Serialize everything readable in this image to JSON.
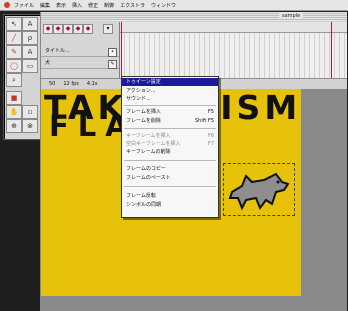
{
  "menubar": {
    "items": [
      "ファイル",
      "編集",
      "表示",
      "挿入",
      "修正",
      "制御",
      "エクストラ",
      "ウィンドウ"
    ]
  },
  "window": {
    "title": "sample"
  },
  "timeline": {
    "layers": [
      {
        "name": "タイトル..."
      },
      {
        "name": "犬"
      }
    ],
    "status": [
      "50",
      "12 fps",
      "4.1s"
    ]
  },
  "stage": {
    "headline_line1": "TAKANOISM",
    "headline_line2": "FLASH"
  },
  "context_menu": {
    "items": [
      {
        "label": "トゥイーン設定",
        "selected": true,
        "disabled": false
      },
      {
        "label": "アクション...",
        "disabled": false
      },
      {
        "label": "サウンド...",
        "disabled": false
      },
      {
        "label": "フレームを挿入",
        "shortcut": "F5",
        "disabled": false
      },
      {
        "label": "フレームを削除",
        "shortcut": "Shift F5",
        "disabled": false
      },
      {
        "label": "キーフレームを挿入",
        "shortcut": "F6",
        "disabled": true
      },
      {
        "label": "空白キーフレームを挿入",
        "shortcut": "F7",
        "disabled": true
      },
      {
        "label": "キーフレームの削除",
        "disabled": false
      },
      {
        "label": "フレームのコピー",
        "disabled": false
      },
      {
        "label": "フレームのペースト",
        "disabled": false
      },
      {
        "label": "フレーム反転",
        "disabled": false
      },
      {
        "label": "シンボルの同期",
        "disabled": false
      }
    ]
  },
  "icons": {
    "tools": [
      "arrow-icon",
      "subselect-icon",
      "line-icon",
      "lasso-icon",
      "pen-icon",
      "text-icon",
      "oval-icon",
      "rect-icon",
      "pencil-icon",
      "brush-icon",
      "ink-bottle-icon",
      "paint-bucket-icon",
      "eyedropper-icon",
      "eraser-icon",
      "hand-icon",
      "zoom-icon"
    ]
  },
  "colors": {
    "stage": "#e6c20b",
    "menu_highlight": "#1c1c96",
    "playhead": "#c8102e"
  }
}
